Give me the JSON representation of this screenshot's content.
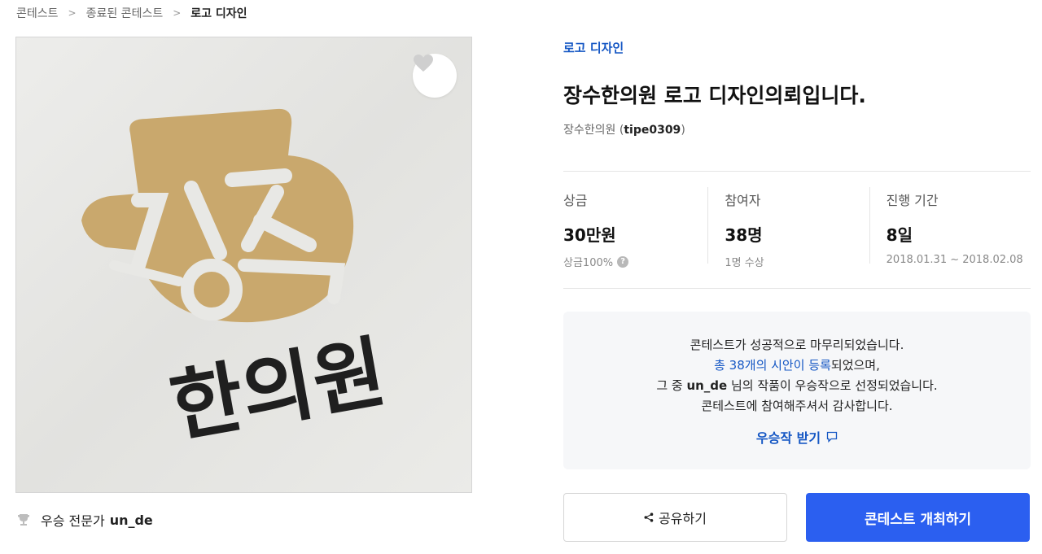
{
  "breadcrumb": {
    "items": [
      "콘테스트",
      "종료된 콘테스트",
      "로고 디자인"
    ]
  },
  "image": {
    "logo_text": "한의원",
    "logo_mark_text": "장수",
    "favorite_icon": "heart-icon"
  },
  "winner": {
    "icon": "trophy-icon",
    "role": "우승 전문가",
    "name": "un_de"
  },
  "contest": {
    "category": "로고 디자인",
    "title": "장수한의원 로고 디자인의뢰입니다.",
    "host_name": "장수한의원",
    "host_id": "tipe0309"
  },
  "stats": [
    {
      "label": "상금",
      "value": "30만원",
      "sub": "상금100%",
      "has_help": true
    },
    {
      "label": "참여자",
      "value": "38명",
      "sub": "1명 수상",
      "has_help": false
    },
    {
      "label": "진행 기간",
      "value": "8일",
      "sub": "2018.01.31 ~ 2018.02.08",
      "has_help": false
    }
  ],
  "notice": {
    "line1": "콘테스트가 성공적으로 마무리되었습니다.",
    "line2_link": "총 38개의 시안이 등록",
    "line2_rest": "되었으며,",
    "line3_pre": "그 중 ",
    "line3_name": "un_de",
    "line3_post": " 님의 작품이 우승작으로 선정되었습니다.",
    "line4": "콘테스트에 참여해주셔서 감사합니다.",
    "receive_label": "우승작 받기"
  },
  "buttons": {
    "share_label": "공유하기",
    "host_label": "콘테스트 개최하기"
  },
  "colors": {
    "accent_blue": "#1557c4",
    "primary_button": "#2b5ff0",
    "logo_gold": "#c9a86d"
  }
}
